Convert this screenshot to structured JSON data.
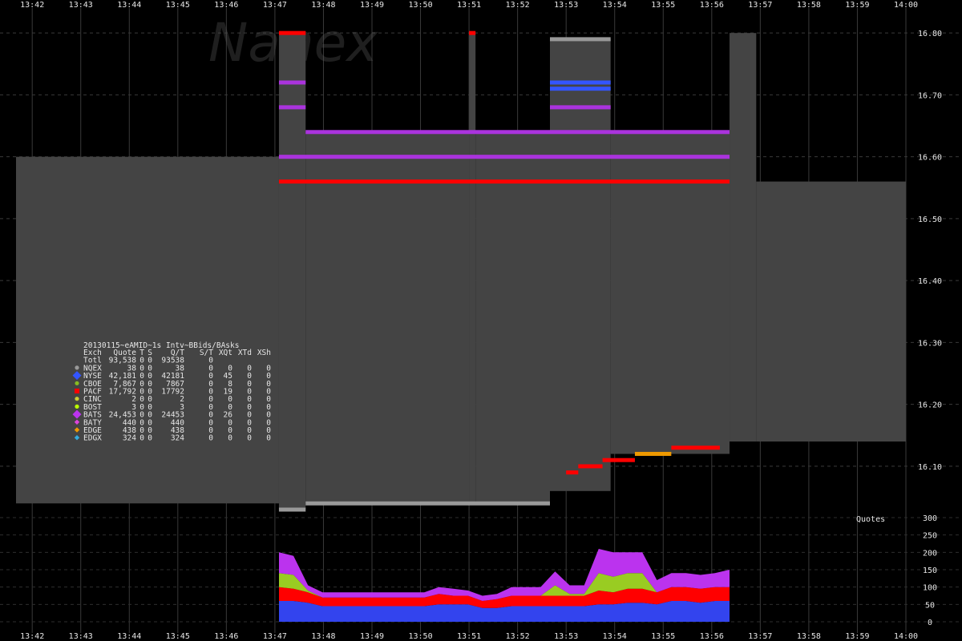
{
  "chart_data": {
    "type": "area",
    "title": "20130115~eAMID~1s Intv~BBids/BAsks",
    "watermark": "Nanex",
    "x_ticks": [
      "13:42",
      "13:43",
      "13:44",
      "13:45",
      "13:46",
      "13:47",
      "13:48",
      "13:49",
      "13:50",
      "13:51",
      "13:52",
      "13:53",
      "13:54",
      "13:55",
      "13:56",
      "13:57",
      "13:58",
      "13:59",
      "14:00"
    ],
    "price_axis": {
      "ticks": [
        "16.80",
        "16.70",
        "16.60",
        "16.50",
        "16.40",
        "16.30",
        "16.20",
        "16.10"
      ],
      "ylim": [
        16.03,
        16.83
      ]
    },
    "quote_axis": {
      "label": "Quotes",
      "ticks": [
        "300",
        "250",
        "200",
        "150",
        "100",
        "50",
        "0"
      ],
      "ylim": [
        0,
        300
      ]
    },
    "grid": true,
    "background_color": "#000000",
    "spread_color": "#444444",
    "spread_segments": [
      {
        "t0": "13:41:40",
        "t1": "13:47:05",
        "ask": 16.6,
        "bid": 16.04
      },
      {
        "t0": "13:47:05",
        "t1": "13:47:38",
        "ask": 16.8,
        "bid": 16.03
      },
      {
        "t0": "13:47:38",
        "t1": "13:51:00",
        "ask": 16.64,
        "bid": 16.04
      },
      {
        "t0": "13:51:00",
        "t1": "13:51:08",
        "ask": 16.8,
        "bid": 16.04
      },
      {
        "t0": "13:51:08",
        "t1": "13:52:40",
        "ask": 16.64,
        "bid": 16.04
      },
      {
        "t0": "13:52:40",
        "t1": "13:53:55",
        "ask": 16.79,
        "bid": 16.06
      },
      {
        "t0": "13:53:55",
        "t1": "13:56:22",
        "ask": 16.64,
        "bid": 16.12
      },
      {
        "t0": "13:56:22",
        "t1": "13:56:55",
        "ask": 16.8,
        "bid": 16.14
      },
      {
        "t0": "13:56:55",
        "t1": "14:00:00",
        "ask": 16.56,
        "bid": 16.14
      }
    ],
    "quote_lines": [
      {
        "exch": "PACF",
        "price": 16.8,
        "t0": "13:47:05",
        "t1": "13:47:38",
        "color": "#ff0000"
      },
      {
        "exch": "PACF",
        "price": 16.8,
        "t0": "13:51:00",
        "t1": "13:51:08",
        "color": "#ff0000"
      },
      {
        "exch": "NQEX",
        "price": 16.79,
        "t0": "13:52:40",
        "t1": "13:53:55",
        "color": "#999999"
      },
      {
        "exch": "BATS",
        "price": 16.72,
        "t0": "13:47:05",
        "t1": "13:47:38",
        "color": "#aa33dd"
      },
      {
        "exch": "BATS",
        "price": 16.68,
        "t0": "13:47:05",
        "t1": "13:47:38",
        "color": "#aa33dd"
      },
      {
        "exch": "NYSE",
        "price": 16.72,
        "t0": "13:52:40",
        "t1": "13:53:55",
        "color": "#3355ff"
      },
      {
        "exch": "NYSE",
        "price": 16.71,
        "t0": "13:52:40",
        "t1": "13:53:55",
        "color": "#3355ff"
      },
      {
        "exch": "BATS",
        "price": 16.68,
        "t0": "13:52:40",
        "t1": "13:53:55",
        "color": "#aa33dd"
      },
      {
        "exch": "BATS",
        "price": 16.64,
        "t0": "13:47:38",
        "t1": "13:56:22",
        "color": "#aa33dd"
      },
      {
        "exch": "BATS",
        "price": 16.6,
        "t0": "13:47:05",
        "t1": "13:56:22",
        "color": "#aa33dd"
      },
      {
        "exch": "PACF",
        "price": 16.56,
        "t0": "13:47:05",
        "t1": "13:56:22",
        "color": "#ff0000"
      },
      {
        "exch": "NQEX",
        "price": 16.04,
        "t0": "13:47:38",
        "t1": "13:52:40",
        "color": "#999999"
      },
      {
        "exch": "NQEX",
        "price": 16.03,
        "t0": "13:47:05",
        "t1": "13:47:38",
        "color": "#999999"
      },
      {
        "exch": "PACF",
        "price": 16.09,
        "t0": "13:53:00",
        "t1": "13:53:15",
        "color": "#ff0000"
      },
      {
        "exch": "PACF",
        "price": 16.1,
        "t0": "13:53:15",
        "t1": "13:53:45",
        "color": "#ff0000"
      },
      {
        "exch": "PACF",
        "price": 16.11,
        "t0": "13:53:45",
        "t1": "13:54:25",
        "color": "#ff0000"
      },
      {
        "exch": "EDGE",
        "price": 16.12,
        "t0": "13:54:25",
        "t1": "13:55:10",
        "color": "#ee9900"
      },
      {
        "exch": "PACF",
        "price": 16.13,
        "t0": "13:55:10",
        "t1": "13:56:10",
        "color": "#ff0000"
      }
    ],
    "volume_series": [
      {
        "name": "NYSE",
        "color": "#3344ee",
        "values": [
          60,
          60,
          55,
          45,
          45,
          45,
          45,
          45,
          45,
          45,
          45,
          50,
          50,
          50,
          40,
          40,
          45,
          45,
          45,
          45,
          45,
          45,
          50,
          50,
          55,
          55,
          50,
          60,
          60,
          55,
          60,
          60
        ]
      },
      {
        "name": "PACF",
        "color": "#ff0000",
        "values": [
          40,
          35,
          30,
          25,
          25,
          25,
          25,
          25,
          25,
          25,
          25,
          30,
          25,
          25,
          20,
          25,
          30,
          30,
          30,
          30,
          30,
          30,
          40,
          35,
          40,
          40,
          35,
          40,
          40,
          40,
          40,
          40
        ]
      },
      {
        "name": "CBOE",
        "color": "#99cc22",
        "values": [
          40,
          40,
          5,
          0,
          0,
          0,
          0,
          0,
          0,
          0,
          0,
          0,
          0,
          0,
          0,
          0,
          0,
          0,
          0,
          30,
          5,
          5,
          50,
          45,
          45,
          45,
          0,
          0,
          0,
          0,
          0,
          0
        ]
      },
      {
        "name": "BATS",
        "color": "#bb33ee",
        "values": [
          60,
          55,
          15,
          15,
          15,
          15,
          15,
          15,
          15,
          15,
          15,
          20,
          20,
          15,
          15,
          15,
          25,
          25,
          25,
          40,
          25,
          25,
          70,
          70,
          60,
          60,
          35,
          40,
          40,
          40,
          40,
          50
        ]
      }
    ],
    "legend_title": "20130115~eAMID~1s Intv~BBids/BAsks",
    "legend_header": [
      "Exch",
      "Quote",
      "T",
      "S",
      "Q/T",
      "S/T",
      "XQt",
      "XTd",
      "XSh"
    ],
    "legend_rows": [
      {
        "exch": "Totl",
        "quote": "93,538",
        "t": "0",
        "s": "0",
        "qt": "93538",
        "st": "0",
        "xqt": "",
        "xtd": "",
        "xsh": "",
        "color": "",
        "marker": "none"
      },
      {
        "exch": "NQEX",
        "quote": "38",
        "t": "0",
        "s": "0",
        "qt": "38",
        "st": "0",
        "xqt": "0",
        "xtd": "0",
        "xsh": "0",
        "color": "#999999",
        "marker": "circle"
      },
      {
        "exch": "NYSE",
        "quote": "42,181",
        "t": "0",
        "s": "0",
        "qt": "42181",
        "st": "0",
        "xqt": "45",
        "xtd": "0",
        "xsh": "0",
        "color": "#3355ff",
        "marker": "diamond"
      },
      {
        "exch": "CBOE",
        "quote": "7,867",
        "t": "0",
        "s": "0",
        "qt": "7867",
        "st": "0",
        "xqt": "8",
        "xtd": "0",
        "xsh": "0",
        "color": "#88bb22",
        "marker": "circle"
      },
      {
        "exch": "PACF",
        "quote": "17,792",
        "t": "0",
        "s": "0",
        "qt": "17792",
        "st": "0",
        "xqt": "19",
        "xtd": "0",
        "xsh": "0",
        "color": "#ff0000",
        "marker": "square"
      },
      {
        "exch": "CINC",
        "quote": "2",
        "t": "0",
        "s": "0",
        "qt": "2",
        "st": "0",
        "xqt": "0",
        "xtd": "0",
        "xsh": "0",
        "color": "#cccc33",
        "marker": "circle"
      },
      {
        "exch": "BOST",
        "quote": "3",
        "t": "0",
        "s": "0",
        "qt": "3",
        "st": "0",
        "xqt": "0",
        "xtd": "0",
        "xsh": "0",
        "color": "#bbff00",
        "marker": "circle"
      },
      {
        "exch": "BATS",
        "quote": "24,453",
        "t": "0",
        "s": "0",
        "qt": "24453",
        "st": "0",
        "xqt": "26",
        "xtd": "0",
        "xsh": "0",
        "color": "#bb33ee",
        "marker": "diamond"
      },
      {
        "exch": "BATY",
        "quote": "440",
        "t": "0",
        "s": "0",
        "qt": "440",
        "st": "0",
        "xqt": "0",
        "xtd": "0",
        "xsh": "0",
        "color": "#dd44dd",
        "marker": "diamond"
      },
      {
        "exch": "EDGE",
        "quote": "438",
        "t": "0",
        "s": "0",
        "qt": "438",
        "st": "0",
        "xqt": "0",
        "xtd": "0",
        "xsh": "0",
        "color": "#ee9900",
        "marker": "diamond"
      },
      {
        "exch": "EDGX",
        "quote": "324",
        "t": "0",
        "s": "0",
        "qt": "324",
        "st": "0",
        "xqt": "0",
        "xtd": "0",
        "xsh": "0",
        "color": "#33aadd",
        "marker": "diamond"
      }
    ]
  }
}
